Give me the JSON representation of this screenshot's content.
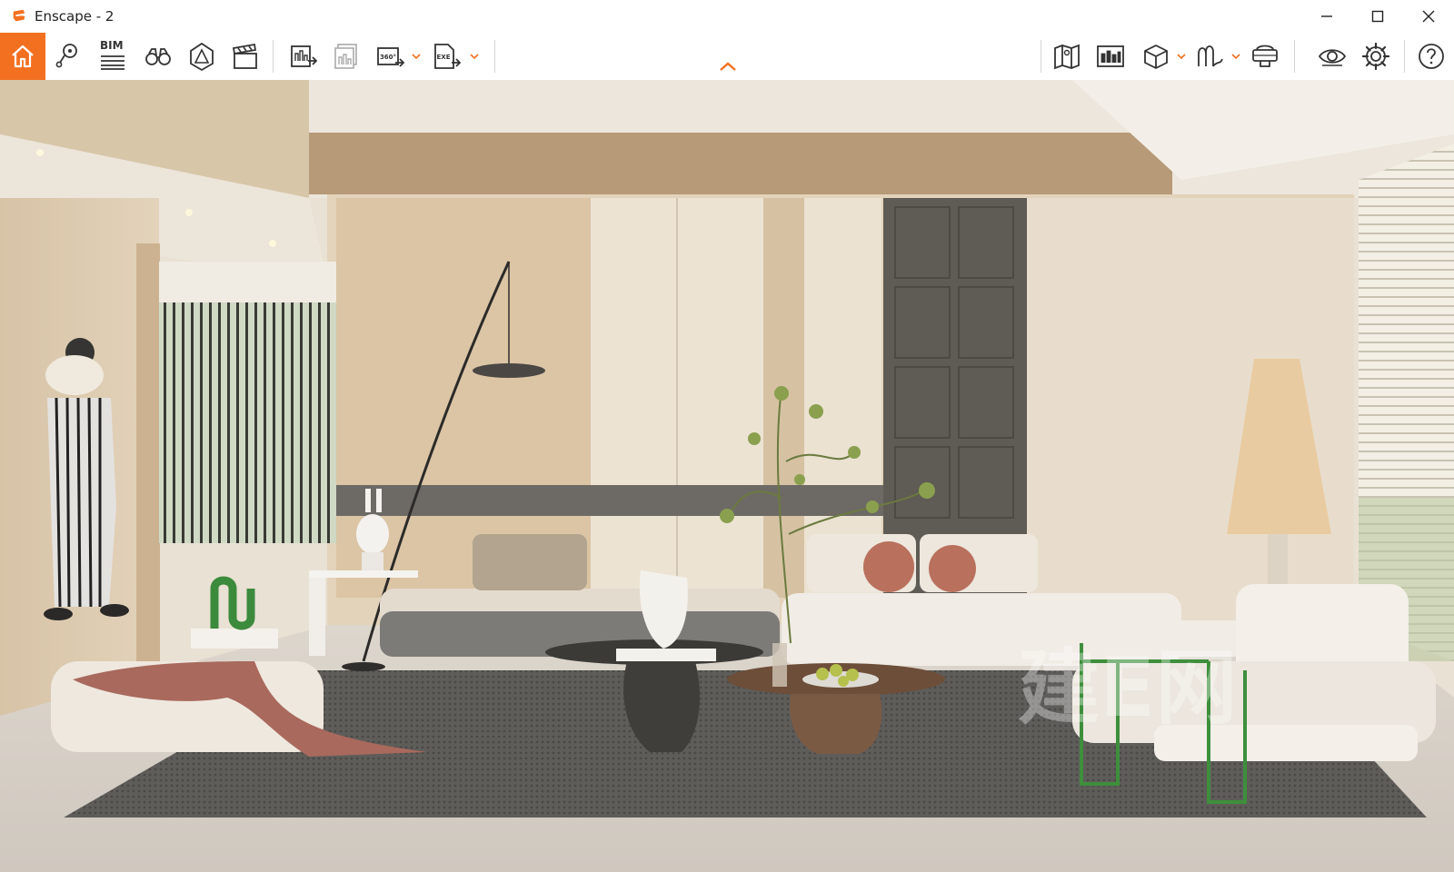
{
  "window": {
    "title": "Enscape - 2",
    "controls": [
      "minimize-icon",
      "maximize-icon",
      "close-icon"
    ]
  },
  "toolbar": {
    "left_buttons": [
      {
        "name": "home-button",
        "icon": "home-icon"
      },
      {
        "name": "views-button",
        "icon": "location-pin-icon"
      },
      {
        "name": "bim-button",
        "icon": "bim-list-icon",
        "label": "BIM"
      },
      {
        "name": "binoculars-button",
        "icon": "binoculars-icon"
      },
      {
        "name": "atmosphere-button",
        "icon": "house-triangle-icon"
      },
      {
        "name": "video-editor-button",
        "icon": "clapperboard-icon"
      },
      {
        "name": "screenshot-export-button",
        "icon": "image-export-icon"
      },
      {
        "name": "batch-render-button",
        "icon": "batch-export-icon"
      },
      {
        "name": "panorama-export-button",
        "icon": "panorama-360-icon",
        "label": "360°"
      },
      {
        "name": "exe-export-button",
        "icon": "exe-export-icon",
        "label": "EXE"
      }
    ],
    "right_buttons": [
      {
        "name": "map-button",
        "icon": "map-icon"
      },
      {
        "name": "city-button",
        "icon": "city-icon"
      },
      {
        "name": "asset-library-button",
        "icon": "cube-icon"
      },
      {
        "name": "materials-button",
        "icon": "wave-icon"
      },
      {
        "name": "vr-headset-button",
        "icon": "vr-headset-icon"
      },
      {
        "name": "visual-settings-button",
        "icon": "eye-icon"
      },
      {
        "name": "settings-button",
        "icon": "gear-icon"
      },
      {
        "name": "help-button",
        "icon": "question-icon"
      }
    ],
    "collapse": "chevron-up-icon"
  },
  "colors": {
    "accent": "#f37021",
    "icon": "#333333",
    "toolbar_bg": "#ffffff"
  },
  "viewport": {
    "content": "interior-render-living-room",
    "watermark_text": "建E网"
  }
}
